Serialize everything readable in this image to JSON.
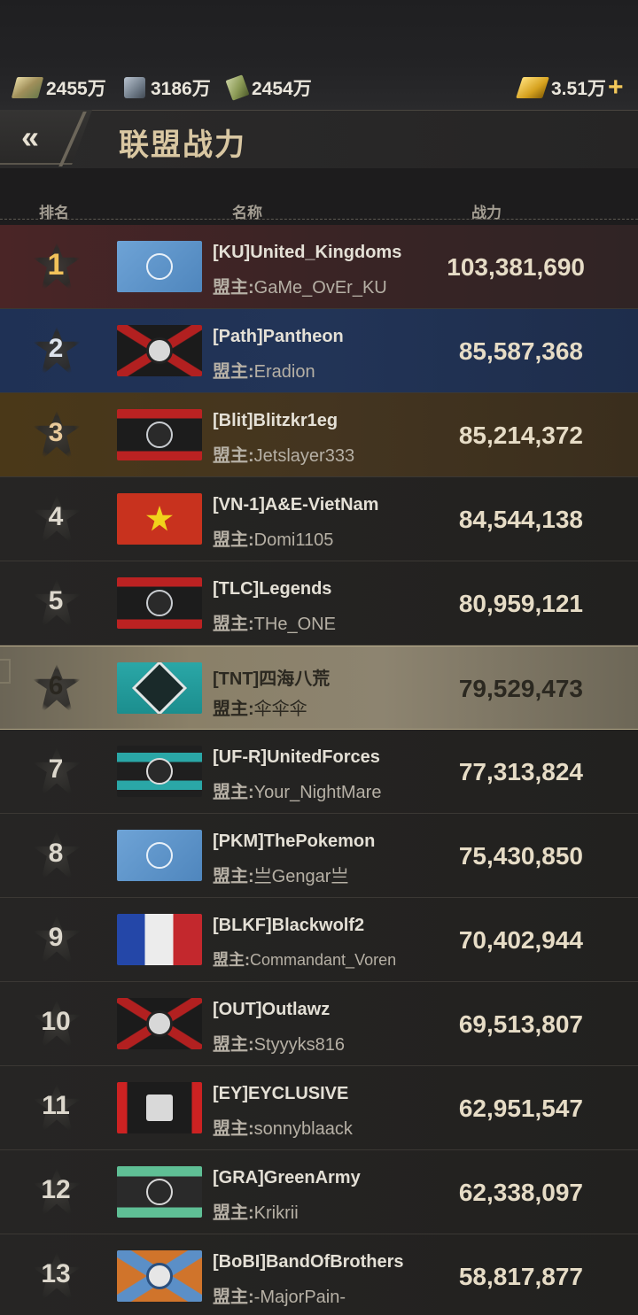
{
  "resources": {
    "money": "2455万",
    "steel": "3186万",
    "fuel": "2454万",
    "gold": "3.51万"
  },
  "header": {
    "back_label": "«",
    "title": "联盟战力"
  },
  "columns": {
    "rank": "排名",
    "name": "名称",
    "power": "战力"
  },
  "leader_prefix": "盟主:",
  "rows": [
    {
      "rank": "1",
      "name": "[KU]United_Kingdoms",
      "leader": "GaMe_OvEr_KU",
      "power": "103,381,690",
      "flag": "un-flag"
    },
    {
      "rank": "2",
      "name": "[Path]Pantheon",
      "leader": "Eradion",
      "power": "85,587,368",
      "flag": "lion-cross-flag"
    },
    {
      "rank": "3",
      "name": "[Blit]Blitzkr1eg",
      "leader": "Jetslayer333",
      "power": "85,214,372",
      "flag": "red-black-star-flag"
    },
    {
      "rank": "4",
      "name": "[VN-1]A&E-VietNam",
      "leader": "Domi1105",
      "power": "84,544,138",
      "flag": "vietnam-flag"
    },
    {
      "rank": "5",
      "name": "[TLC]Legends",
      "leader": "THe_ONE",
      "power": "80,959,121",
      "flag": "red-black-star-flag"
    },
    {
      "rank": "6",
      "name": "[TNT]四海八荒",
      "leader": "伞伞伞",
      "power": "79,529,473",
      "flag": "teal-skull-flag"
    },
    {
      "rank": "7",
      "name": "[UF-R]UnitedForces",
      "leader": "Your_NightMare",
      "power": "77,313,824",
      "flag": "teal-stripe-star-flag"
    },
    {
      "rank": "8",
      "name": "[PKM]ThePokemon",
      "leader": "亗Gengar亗",
      "power": "75,430,850",
      "flag": "un-flag"
    },
    {
      "rank": "9",
      "name": "[BLKF]Blackwolf2",
      "leader": "Commandant_Voren",
      "power": "70,402,944",
      "flag": "france-flag"
    },
    {
      "rank": "10",
      "name": "[OUT]Outlawz",
      "leader": "Styyyks816",
      "power": "69,513,807",
      "flag": "shield-cross-flag"
    },
    {
      "rank": "11",
      "name": "[EY]EYCLUSIVE",
      "leader": "sonnyblaack",
      "power": "62,951,547",
      "flag": "red-side-emblem-flag"
    },
    {
      "rank": "12",
      "name": "[GRA]GreenArmy",
      "leader": "Krikrii",
      "power": "62,338,097",
      "flag": "green-radiation-flag"
    },
    {
      "rank": "13",
      "name": "[BoBI]BandOfBrothers",
      "leader": "-MajorPain-",
      "power": "58,817,877",
      "flag": "orange-lion-flag"
    }
  ]
}
